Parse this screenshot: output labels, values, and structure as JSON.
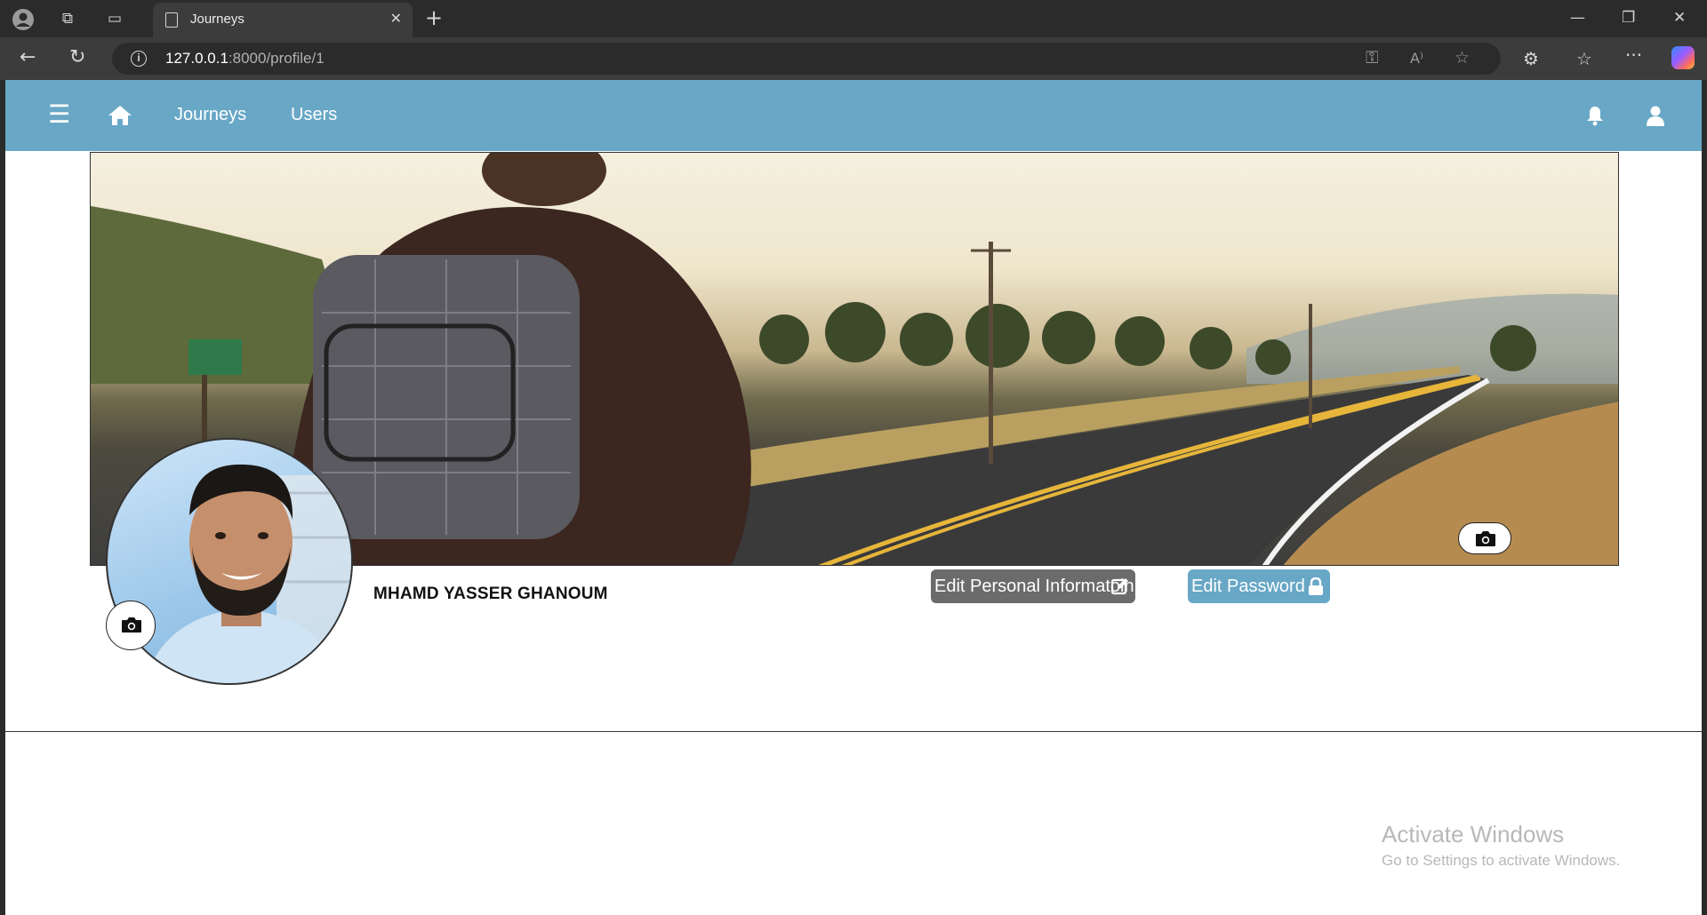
{
  "browser": {
    "tab_title": "Journeys",
    "url_host": "127.0.0.1",
    "url_rest": ":8000/profile/1"
  },
  "navbar": {
    "links": [
      "Journeys",
      "Users"
    ],
    "bg_color": "#68a7c6"
  },
  "profile": {
    "name": "MHAMD YASSER GHANOUM",
    "edit_info_label": "Edit Personal Informatoin",
    "edit_password_label": "Edit Password"
  },
  "watermark": {
    "title": "Activate Windows",
    "subtitle": "Go to Settings to activate Windows."
  },
  "icons": [
    "menu-icon",
    "home-icon",
    "bell-icon",
    "user-icon",
    "camera-icon",
    "edit-icon",
    "lock-icon"
  ]
}
